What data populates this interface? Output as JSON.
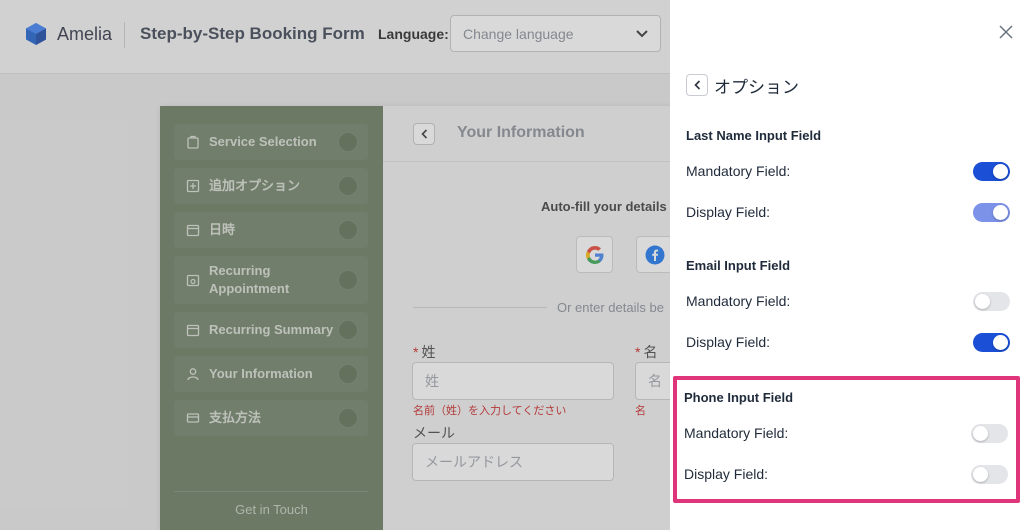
{
  "header": {
    "logo_text": "Amelia",
    "page_title": "Step-by-Step Booking Form",
    "language_label": "Language:",
    "language_select": "Change language"
  },
  "sidebar": {
    "items": [
      {
        "label": "Service Selection",
        "icon": "service-icon"
      },
      {
        "label": "追加オプション",
        "icon": "plus-square-icon"
      },
      {
        "label": "日時",
        "icon": "calendar-icon"
      },
      {
        "label": "Recurring Appointment",
        "icon": "calendar-repeat-icon"
      },
      {
        "label": "Recurring Summary",
        "icon": "calendar-icon"
      },
      {
        "label": "Your Information",
        "icon": "user-icon"
      },
      {
        "label": "支払方法",
        "icon": "payment-card-icon"
      }
    ],
    "footer": "Get in Touch"
  },
  "form": {
    "title": "Your Information",
    "autofill": "Auto-fill your details",
    "or_text": "Or enter details be",
    "last_name_label": "姓",
    "last_name_placeholder": "姓",
    "last_name_error": "名前（姓）を入力してください",
    "first_name_label": "名",
    "first_name_placeholder": "名",
    "first_name_error": "名",
    "email_label": "メール",
    "email_placeholder": "メールアドレス"
  },
  "drawer": {
    "title": "オプション",
    "sections": [
      {
        "title": "Last Name Input Field",
        "mandatory_label": "Mandatory Field:",
        "mandatory": true,
        "display_label": "Display Field:",
        "display": true
      },
      {
        "title": "Email Input Field",
        "mandatory_label": "Mandatory Field:",
        "mandatory": false,
        "display_label": "Display Field:",
        "display": true
      },
      {
        "title": "Phone Input Field",
        "mandatory_label": "Mandatory Field:",
        "mandatory": false,
        "display_label": "Display Field:",
        "display": false
      }
    ]
  },
  "colors": {
    "toggle_on": "#1a4fd6",
    "toggle_on_light": "#7c92e8",
    "toggle_off": "#e3e5e8",
    "highlight": "#e0357a",
    "sidebar_bg": "#677a5f"
  }
}
